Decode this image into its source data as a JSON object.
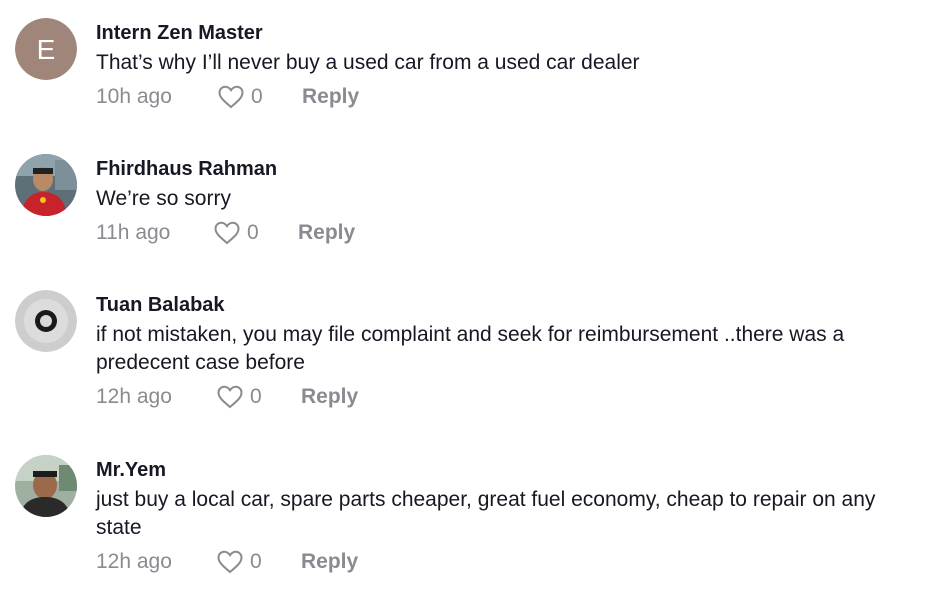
{
  "comments": [
    {
      "avatar_type": "letter",
      "avatar_letter": "E",
      "avatar_color": "#a0857b",
      "username": "Intern Zen Master",
      "text": "That’s why I’ll never buy a used car from a used car dealer",
      "time": "10h ago",
      "likes": "0",
      "reply": "Reply"
    },
    {
      "avatar_type": "photo",
      "username": "Fhirdhaus Rahman",
      "text": "We’re so sorry",
      "time": "11h ago",
      "likes": "0",
      "reply": "Reply"
    },
    {
      "avatar_type": "ring",
      "username": "Tuan Balabak",
      "text": "if not mistaken, you may file complaint and seek for reimbursement ..there was a predecent case before",
      "time": "12h ago",
      "likes": "0",
      "reply": "Reply"
    },
    {
      "avatar_type": "photo",
      "username": "Mr.Yem",
      "text": "just buy a local car, spare parts cheaper, great fuel economy, cheap to repair on any state",
      "time": "12h ago",
      "likes": "0",
      "reply": "Reply"
    }
  ],
  "colors": {
    "meta_text": "#8a8b91",
    "main_text": "#161823"
  },
  "icons": {
    "like": "heart-outline-icon"
  }
}
